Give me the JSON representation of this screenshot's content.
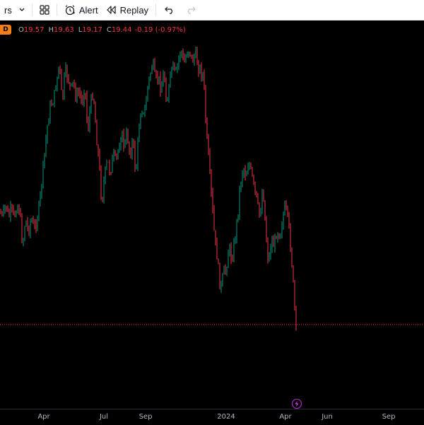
{
  "toolbar": {
    "indicators_label": "rs",
    "alert_label": "Alert",
    "replay_label": "Replay",
    "icons": [
      "chevron-down-icon",
      "templates-grid-icon",
      "alarm-clock-icon",
      "replay-rewind-icon",
      "undo-icon",
      "redo-icon"
    ]
  },
  "legend": {
    "interval": "D",
    "open_key": "O",
    "open": "19.57",
    "high_key": "H",
    "high": "19.63",
    "low_key": "L",
    "low": "19.17",
    "close_key": "C",
    "close": "19.44",
    "change": "-0.19 (-0.97%)"
  },
  "colors": {
    "background": "#000000",
    "up": "#089981",
    "down": "#f23645",
    "price_line": "#f23645",
    "axis_text": "#b2b5be",
    "interval_badge": "#f57f17"
  },
  "chart_data": {
    "type": "candlestick",
    "x_tick_labels": [
      "Apr",
      "Jul",
      "Sep",
      "2024",
      "Apr",
      "Jun",
      "Sep"
    ],
    "last_close": 19.44,
    "price_path": [
      [
        0,
        0.58
      ],
      [
        4,
        0.6
      ],
      [
        8,
        0.55
      ],
      [
        12,
        0.6
      ],
      [
        16,
        0.57
      ],
      [
        20,
        0.6
      ],
      [
        24,
        0.55
      ],
      [
        28,
        0.58
      ],
      [
        32,
        0.7
      ],
      [
        36,
        0.6
      ],
      [
        40,
        0.65
      ],
      [
        44,
        0.6
      ],
      [
        48,
        0.64
      ],
      [
        52,
        0.61
      ],
      [
        56,
        0.55
      ],
      [
        60,
        0.45
      ],
      [
        64,
        0.35
      ],
      [
        68,
        0.25
      ],
      [
        72,
        0.2
      ],
      [
        76,
        0.18
      ],
      [
        80,
        0.12
      ],
      [
        84,
        0.05
      ],
      [
        88,
        0.2
      ],
      [
        92,
        0.08
      ],
      [
        96,
        0.1
      ],
      [
        100,
        0.15
      ],
      [
        104,
        0.12
      ],
      [
        108,
        0.18
      ],
      [
        112,
        0.15
      ],
      [
        116,
        0.2
      ],
      [
        120,
        0.12
      ],
      [
        124,
        0.3
      ],
      [
        128,
        0.2
      ],
      [
        132,
        0.15
      ],
      [
        136,
        0.3
      ],
      [
        140,
        0.4
      ],
      [
        144,
        0.55
      ],
      [
        148,
        0.45
      ],
      [
        152,
        0.4
      ],
      [
        156,
        0.44
      ],
      [
        160,
        0.38
      ],
      [
        164,
        0.4
      ],
      [
        168,
        0.35
      ],
      [
        172,
        0.3
      ],
      [
        176,
        0.35
      ],
      [
        180,
        0.3
      ],
      [
        184,
        0.38
      ],
      [
        188,
        0.32
      ],
      [
        192,
        0.45
      ],
      [
        196,
        0.3
      ],
      [
        200,
        0.2
      ],
      [
        204,
        0.25
      ],
      [
        208,
        0.15
      ],
      [
        212,
        0.1
      ],
      [
        216,
        0.05
      ],
      [
        220,
        0.12
      ],
      [
        224,
        0.1
      ],
      [
        228,
        0.15
      ],
      [
        232,
        0.08
      ],
      [
        236,
        0.2
      ],
      [
        240,
        0.12
      ],
      [
        244,
        0.06
      ],
      [
        248,
        0.1
      ],
      [
        252,
        0.05
      ],
      [
        256,
        0.0
      ],
      [
        260,
        0.06
      ],
      [
        264,
        0.02
      ],
      [
        268,
        0.0
      ],
      [
        272,
        0.05
      ],
      [
        276,
        0.02
      ],
      [
        280,
        0.06
      ],
      [
        284,
        0.08
      ],
      [
        288,
        0.1
      ],
      [
        292,
        0.3
      ],
      [
        296,
        0.42
      ],
      [
        300,
        0.55
      ],
      [
        304,
        0.68
      ],
      [
        308,
        0.75
      ],
      [
        312,
        0.86
      ],
      [
        316,
        0.8
      ],
      [
        320,
        0.78
      ],
      [
        324,
        0.7
      ],
      [
        328,
        0.75
      ],
      [
        332,
        0.68
      ],
      [
        336,
        0.6
      ],
      [
        340,
        0.48
      ],
      [
        344,
        0.42
      ],
      [
        348,
        0.45
      ],
      [
        352,
        0.4
      ],
      [
        356,
        0.45
      ],
      [
        360,
        0.5
      ],
      [
        364,
        0.55
      ],
      [
        368,
        0.6
      ],
      [
        372,
        0.48
      ],
      [
        376,
        0.65
      ],
      [
        380,
        0.76
      ],
      [
        384,
        0.68
      ],
      [
        388,
        0.7
      ],
      [
        392,
        0.64
      ],
      [
        396,
        0.66
      ],
      [
        400,
        0.6
      ],
      [
        404,
        0.56
      ],
      [
        408,
        0.62
      ],
      [
        412,
        0.72
      ],
      [
        416,
        0.88
      ],
      [
        419,
        1.0
      ]
    ],
    "grid": false
  }
}
